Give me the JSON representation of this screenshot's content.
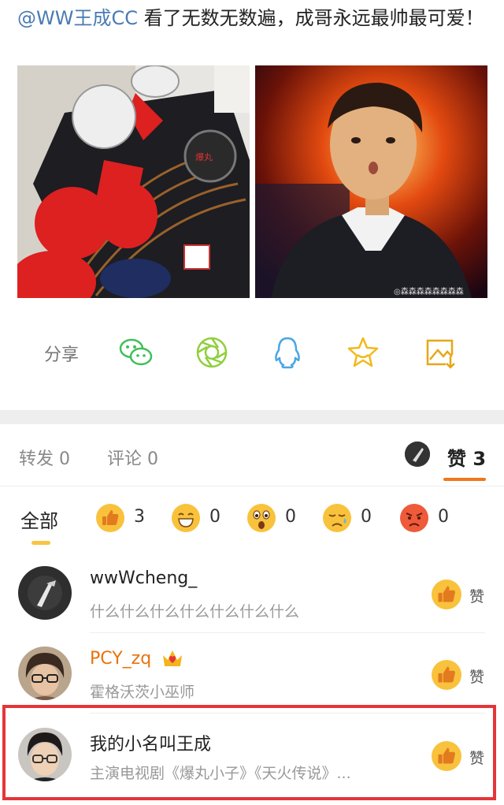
{
  "post": {
    "mention": "@WW王成CC",
    "text": " 看了无数无数遍，成哥永远最帅最可爱！"
  },
  "share": {
    "label": "分享",
    "icons": [
      "wechat-icon",
      "moments-icon",
      "qq-icon",
      "favorite-star-icon",
      "save-image-icon"
    ]
  },
  "tabs": {
    "repost": "转发 0",
    "comment": "评论 0",
    "like": "赞 3"
  },
  "reactions": {
    "all": "全部",
    "items": [
      {
        "name": "thumbs-up-emoji",
        "count": "3"
      },
      {
        "name": "laugh-emoji",
        "count": "0"
      },
      {
        "name": "wow-emoji",
        "count": "0"
      },
      {
        "name": "sad-emoji",
        "count": "0"
      },
      {
        "name": "angry-emoji",
        "count": "0"
      }
    ]
  },
  "likers": [
    {
      "name": "wwWcheng_",
      "bio": "什么什么什么什么什么什么什么",
      "like_label": "赞"
    },
    {
      "name": "PCY_zq",
      "bio": "霍格沃茨小巫师",
      "like_label": "赞"
    },
    {
      "name": "我的小名叫王成",
      "bio": "主演电视剧《爆丸小子》《天火传说》...",
      "like_label": "赞"
    }
  ],
  "colors": {
    "accent_orange": "#f0761f",
    "mention_blue": "#4a7bb3",
    "highlight_red": "#e53538",
    "reaction_yellow": "#f7c543"
  }
}
